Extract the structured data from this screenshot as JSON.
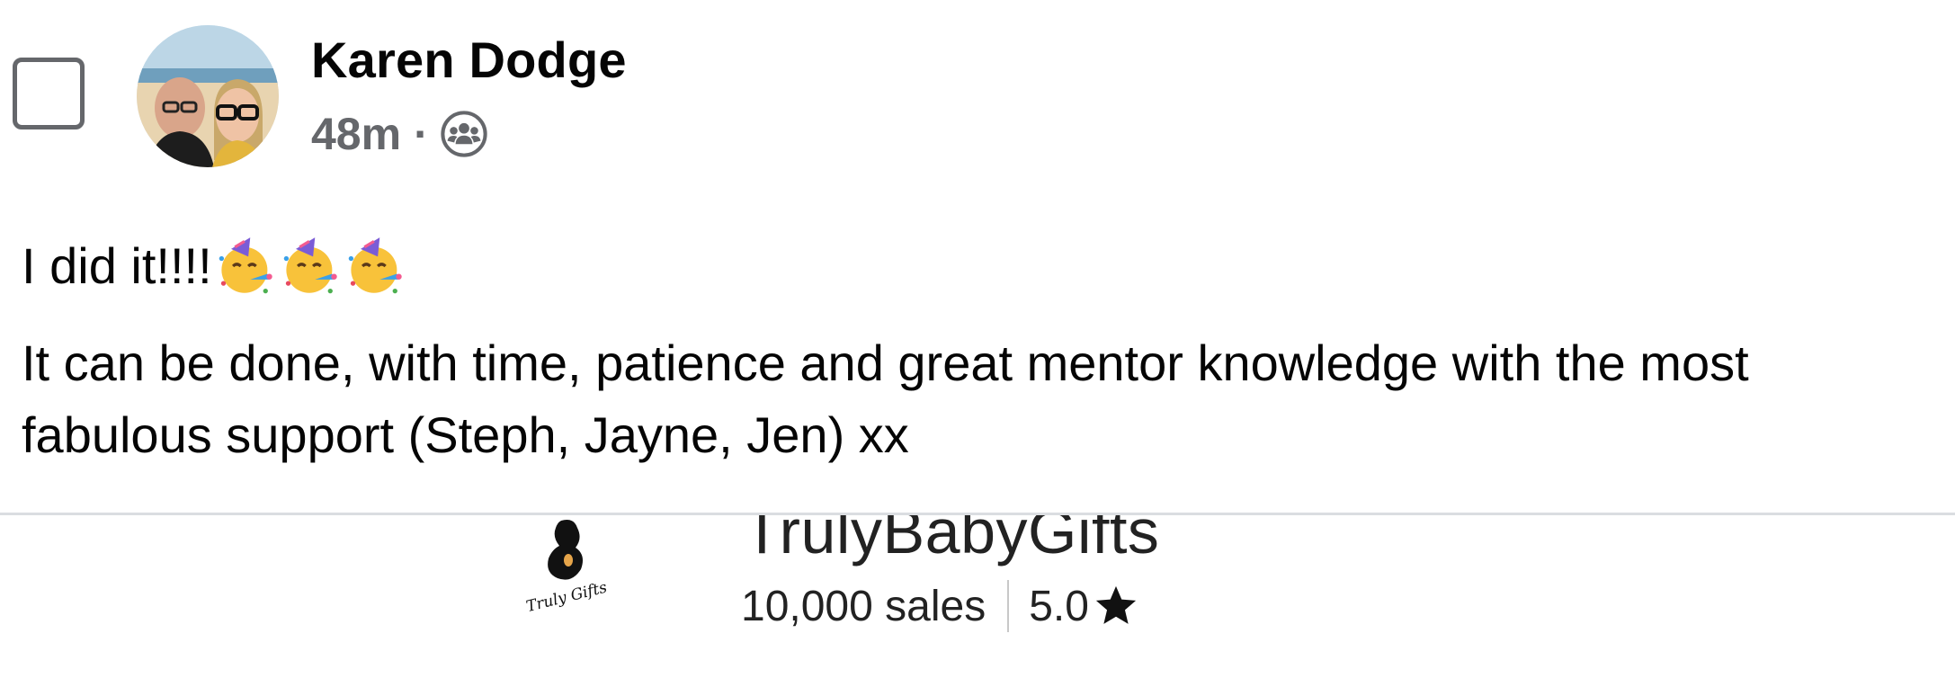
{
  "post": {
    "author_name": "Karen Dodge",
    "timestamp": "48m",
    "separator": "·",
    "audience_icon": "group-icon",
    "text_line1": "I did it!!!!",
    "emojis": [
      "partying-face-icon",
      "partying-face-icon",
      "partying-face-icon"
    ],
    "text_body": "It can be done, with time, patience and great mentor knowledge with the most fabulous support (Steph, Jayne, Jen) xx"
  },
  "shop": {
    "name": "TrulyBabyGifts",
    "logo_text": "Truly Gifts",
    "sales": "10,000 sales",
    "rating": "5.0",
    "rating_icon": "star-icon"
  }
}
